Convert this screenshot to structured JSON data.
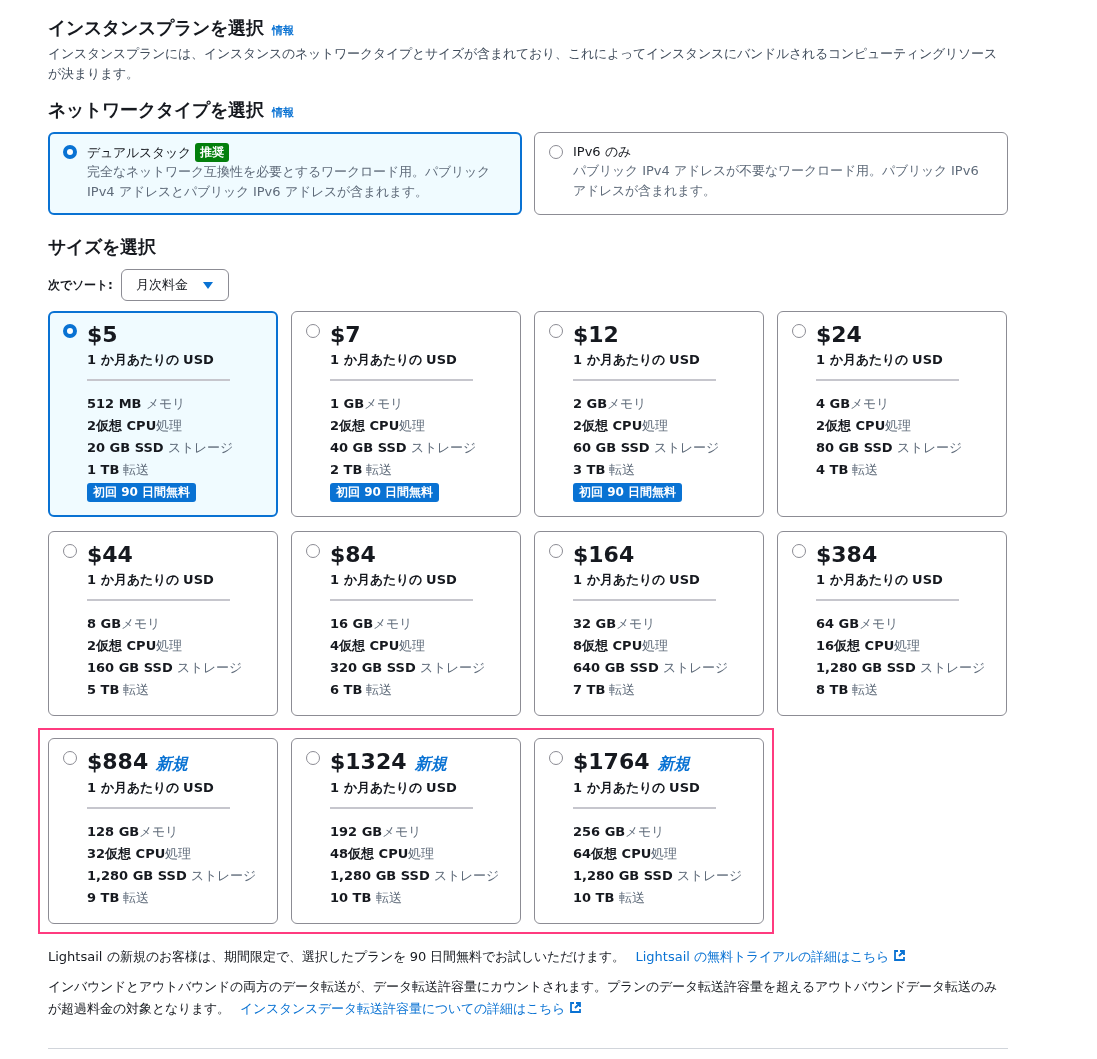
{
  "plan_section": {
    "title": "インスタンスプランを選択",
    "info_link": "情報",
    "description": "インスタンスプランには、インスタンスのネットワークタイプとサイズが含まれており、これによってインスタンスにバンドルされるコンピューティングリソースが決まります。"
  },
  "network_section": {
    "title": "ネットワークタイプを選択",
    "info_link": "情報",
    "options": [
      {
        "label": "デュアルスタック",
        "badge": "推奨",
        "description": "完全なネットワーク互換性を必要とするワークロード用。パブリック IPv4 アドレスとパブリック IPv6 アドレスが含まれます。",
        "selected": true
      },
      {
        "label": "IPv6 のみ",
        "description": "パブリック IPv4 アドレスが不要なワークロード用。パブリック IPv6 アドレスが含まれます。",
        "selected": false
      }
    ]
  },
  "size_section": {
    "title": "サイズを選択",
    "sort_label": "次でソート:",
    "sort_value": "月次料金",
    "rows": [
      {
        "highlighted": false,
        "plans": [
          {
            "price": "$5",
            "period": "1 か月あたりの USD",
            "specs": [
              "**512 MB** メモリ",
              "**2仮想 CPU**処理",
              "**20 GB SSD** ストレージ",
              "**1 TB** 転送"
            ],
            "badge": "初回 90 日間無料",
            "selected": true
          },
          {
            "price": "$7",
            "period": "1 か月あたりの USD",
            "specs": [
              "**1 GB**メモリ",
              "**2仮想 CPU**処理",
              "**40 GB SSD** ストレージ",
              "**2 TB** 転送"
            ],
            "badge": "初回 90 日間無料",
            "selected": false
          },
          {
            "price": "$12",
            "period": "1 か月あたりの USD",
            "specs": [
              "**2 GB**メモリ",
              "**2仮想 CPU**処理",
              "**60 GB SSD** ストレージ",
              "**3 TB** 転送"
            ],
            "badge": "初回 90 日間無料",
            "selected": false
          },
          {
            "price": "$24",
            "period": "1 か月あたりの USD",
            "specs": [
              "**4 GB**メモリ",
              "**2仮想 CPU**処理",
              "**80 GB SSD** ストレージ",
              "**4 TB** 転送"
            ],
            "selected": false
          }
        ]
      },
      {
        "highlighted": false,
        "plans": [
          {
            "price": "$44",
            "period": "1 か月あたりの USD",
            "specs": [
              "**8 GB**メモリ",
              "**2仮想 CPU**処理",
              "**160 GB SSD** ストレージ",
              "**5 TB** 転送"
            ],
            "selected": false
          },
          {
            "price": "$84",
            "period": "1 か月あたりの USD",
            "specs": [
              "**16 GB**メモリ",
              "**4仮想 CPU**処理",
              "**320 GB SSD** ストレージ",
              "**6 TB** 転送"
            ],
            "selected": false
          },
          {
            "price": "$164",
            "period": "1 か月あたりの USD",
            "specs": [
              "**32 GB**メモリ",
              "**8仮想 CPU**処理",
              "**640 GB SSD** ストレージ",
              "**7 TB** 転送"
            ],
            "selected": false
          },
          {
            "price": "$384",
            "period": "1 か月あたりの USD",
            "specs": [
              "**64 GB**メモリ",
              "**16仮想 CPU**処理",
              "**1,280 GB SSD** ストレージ",
              "**8 TB** 転送"
            ],
            "selected": false
          }
        ]
      },
      {
        "highlighted": true,
        "plans": [
          {
            "price": "$884",
            "new_tag": "新規",
            "period": "1 か月あたりの USD",
            "specs": [
              "**128 GB**メモリ",
              "**32仮想 CPU**処理",
              "**1,280 GB SSD** ストレージ",
              "**9 TB** 転送"
            ],
            "selected": false
          },
          {
            "price": "$1324",
            "new_tag": "新規",
            "period": "1 か月あたりの USD",
            "specs": [
              "**192 GB**メモリ",
              "**48仮想 CPU**処理",
              "**1,280 GB SSD** ストレージ",
              "**10 TB** 転送"
            ],
            "selected": false
          },
          {
            "price": "$1764",
            "new_tag": "新規",
            "period": "1 か月あたりの USD",
            "specs": [
              "**256 GB**メモリ",
              "**64仮想 CPU**処理",
              "**1,280 GB SSD** ストレージ",
              "**10 TB** 転送"
            ],
            "selected": false
          }
        ]
      }
    ]
  },
  "notes": [
    {
      "text": "Lightsail の新規のお客様は、期間限定で、選択したプランを 90 日間無料でお試しいただけます。",
      "link": "Lightsail の無料トライアルの詳細はこちら"
    },
    {
      "text": "インバウンドとアウトバウンドの両方のデータ転送が、データ転送許容量にカウントされます。プランのデータ転送許容量を超えるアウトバウンドデータ転送のみが超過料金の対象となります。",
      "link": "インスタンスデータ転送許容量についての詳細はこちら"
    }
  ]
}
